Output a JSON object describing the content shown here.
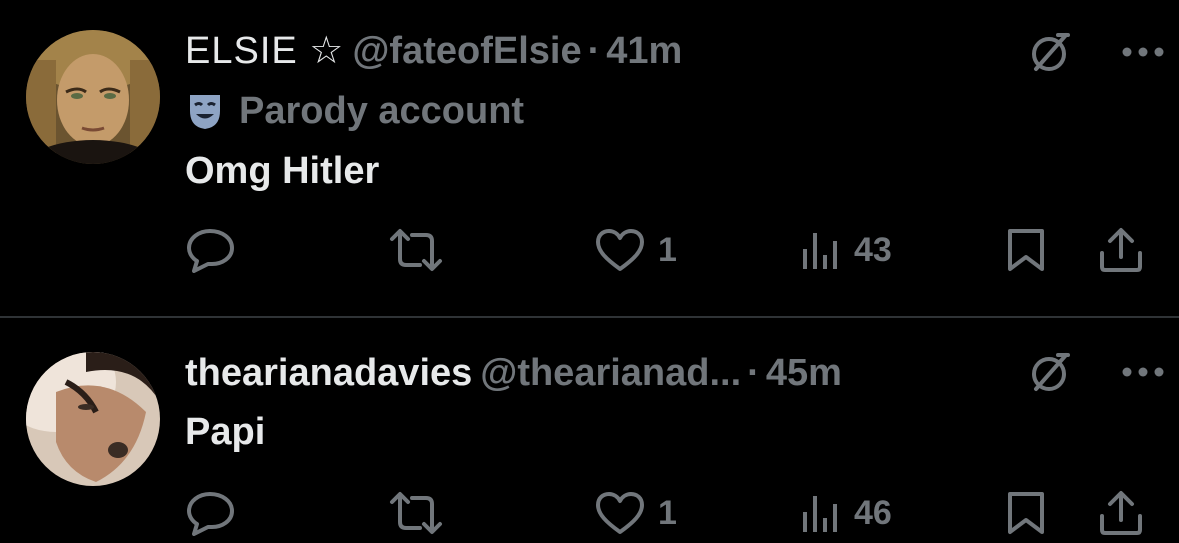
{
  "tweets": [
    {
      "display_name": "ELSIE ☆",
      "handle": "@fateofElsie",
      "separator": "·",
      "time": "41m",
      "label_icon": "theater-mask-icon",
      "label_text": "Parody account",
      "text": "Omg Hitler",
      "reply_count": "",
      "retweet_count": "",
      "like_count": "1",
      "view_count": "43"
    },
    {
      "display_name": "thearianadavies",
      "handle": "@thearianad...",
      "separator": "·",
      "time": "45m",
      "text": "Papi",
      "reply_count": "",
      "retweet_count": "",
      "like_count": "1",
      "view_count": "46"
    }
  ],
  "colors": {
    "background": "#000000",
    "primary_text": "#e7e9ea",
    "secondary_text": "#71767b",
    "divider": "#2f3336",
    "parody_mask": "#8ea4c4"
  },
  "icons": {
    "reply": "reply-icon",
    "retweet": "retweet-icon",
    "like": "like-icon",
    "views": "views-icon",
    "bookmark": "bookmark-icon",
    "share": "share-icon",
    "grok": "grok-icon",
    "more": "more-icon"
  }
}
